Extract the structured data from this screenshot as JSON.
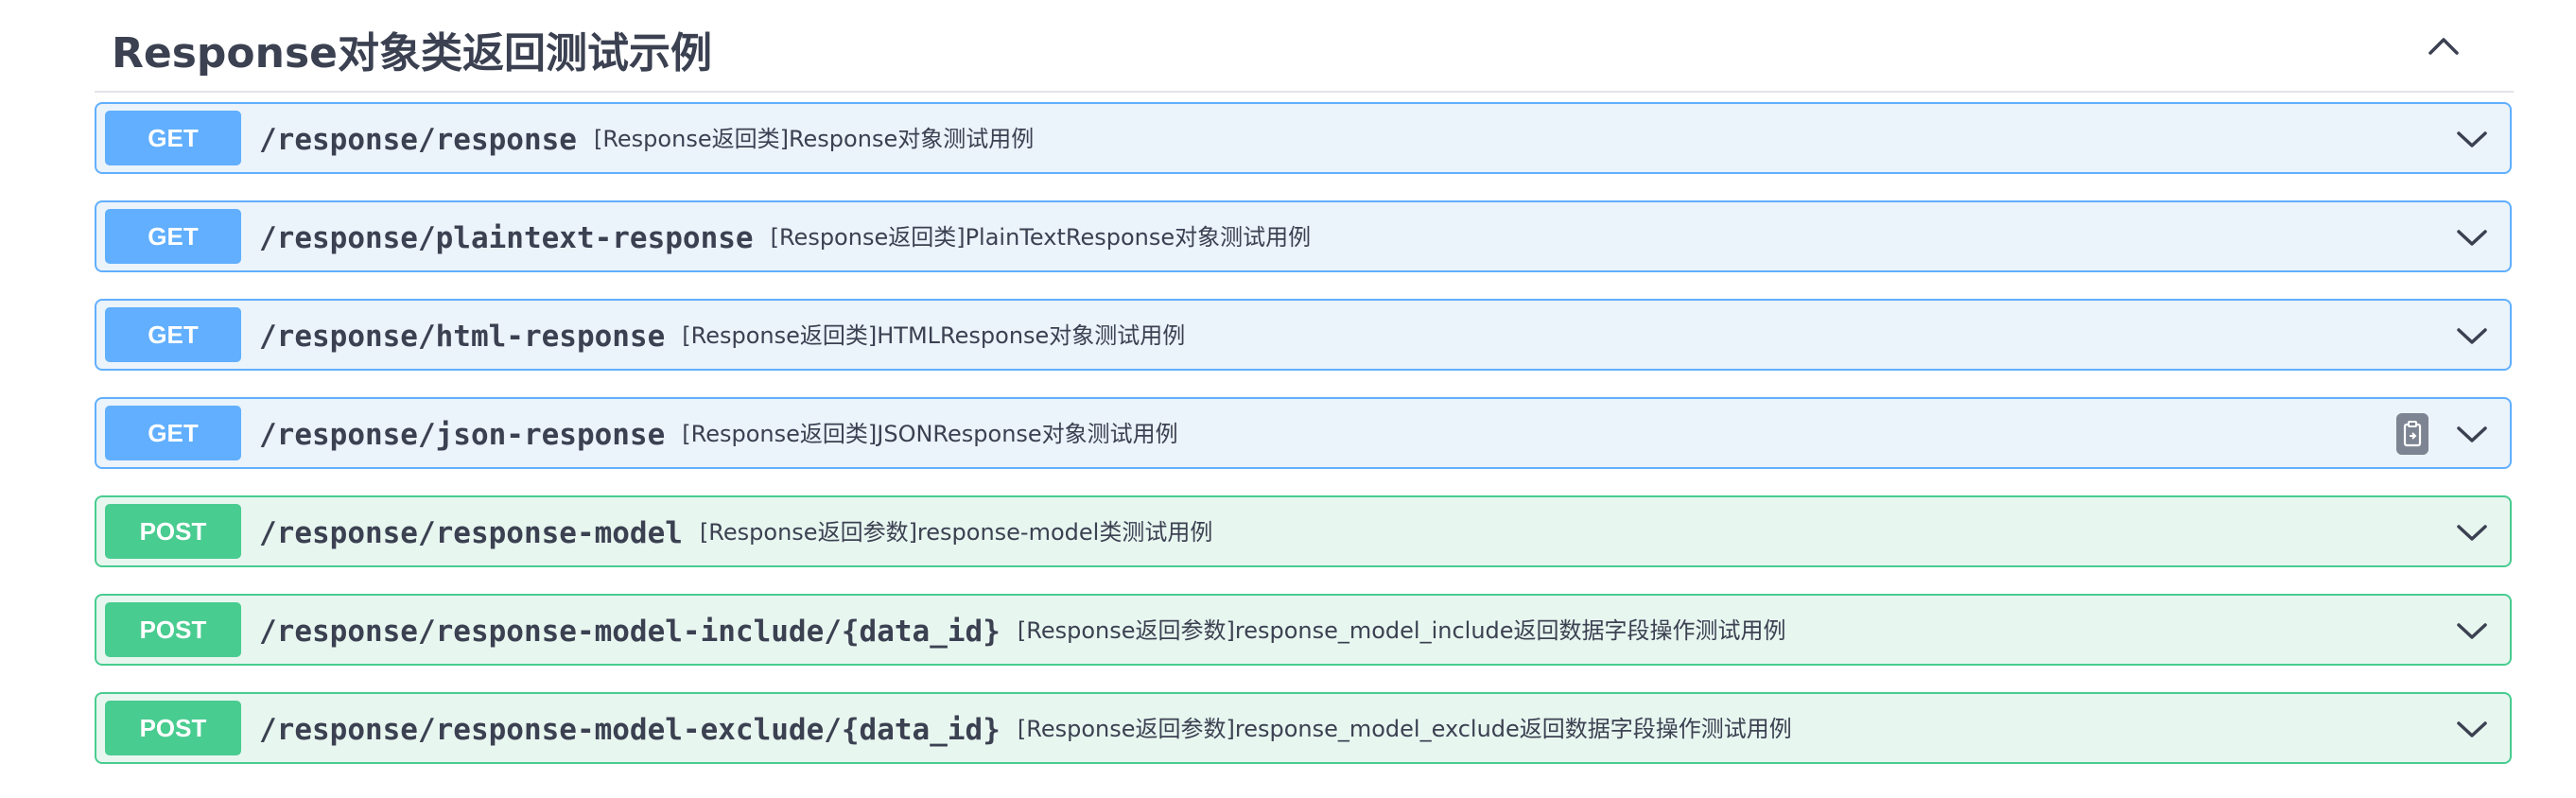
{
  "section": {
    "title": "Response对象类返回测试示例",
    "toggle_icon": "chevron-up-icon"
  },
  "colors": {
    "get": "#61affe",
    "get_bg": "#ebf3fb",
    "post": "#49cc90",
    "post_bg": "#e8f6f0",
    "text": "#3b4151"
  },
  "operations": [
    {
      "method": "GET",
      "path": "/response/response",
      "summary": "[Response返回类]Response对象测试用例"
    },
    {
      "method": "GET",
      "path": "/response/plaintext-response",
      "summary": "[Response返回类]PlainTextResponse对象测试用例"
    },
    {
      "method": "GET",
      "path": "/response/html-response",
      "summary": "[Response返回类]HTMLResponse对象测试用例"
    },
    {
      "method": "GET",
      "path": "/response/json-response",
      "summary": "[Response返回类]JSONResponse对象测试用例",
      "copy_icon": "copy-to-clipboard-icon"
    },
    {
      "method": "POST",
      "path": "/response/response-model",
      "summary": "[Response返回参数]response-model类测试用例"
    },
    {
      "method": "POST",
      "path": "/response/response-model-include/{data_id}",
      "summary": "[Response返回参数]response_model_include返回数据字段操作测试用例"
    },
    {
      "method": "POST",
      "path": "/response/response-model-exclude/{data_id}",
      "summary": "[Response返回参数]response_model_exclude返回数据字段操作测试用例"
    }
  ]
}
